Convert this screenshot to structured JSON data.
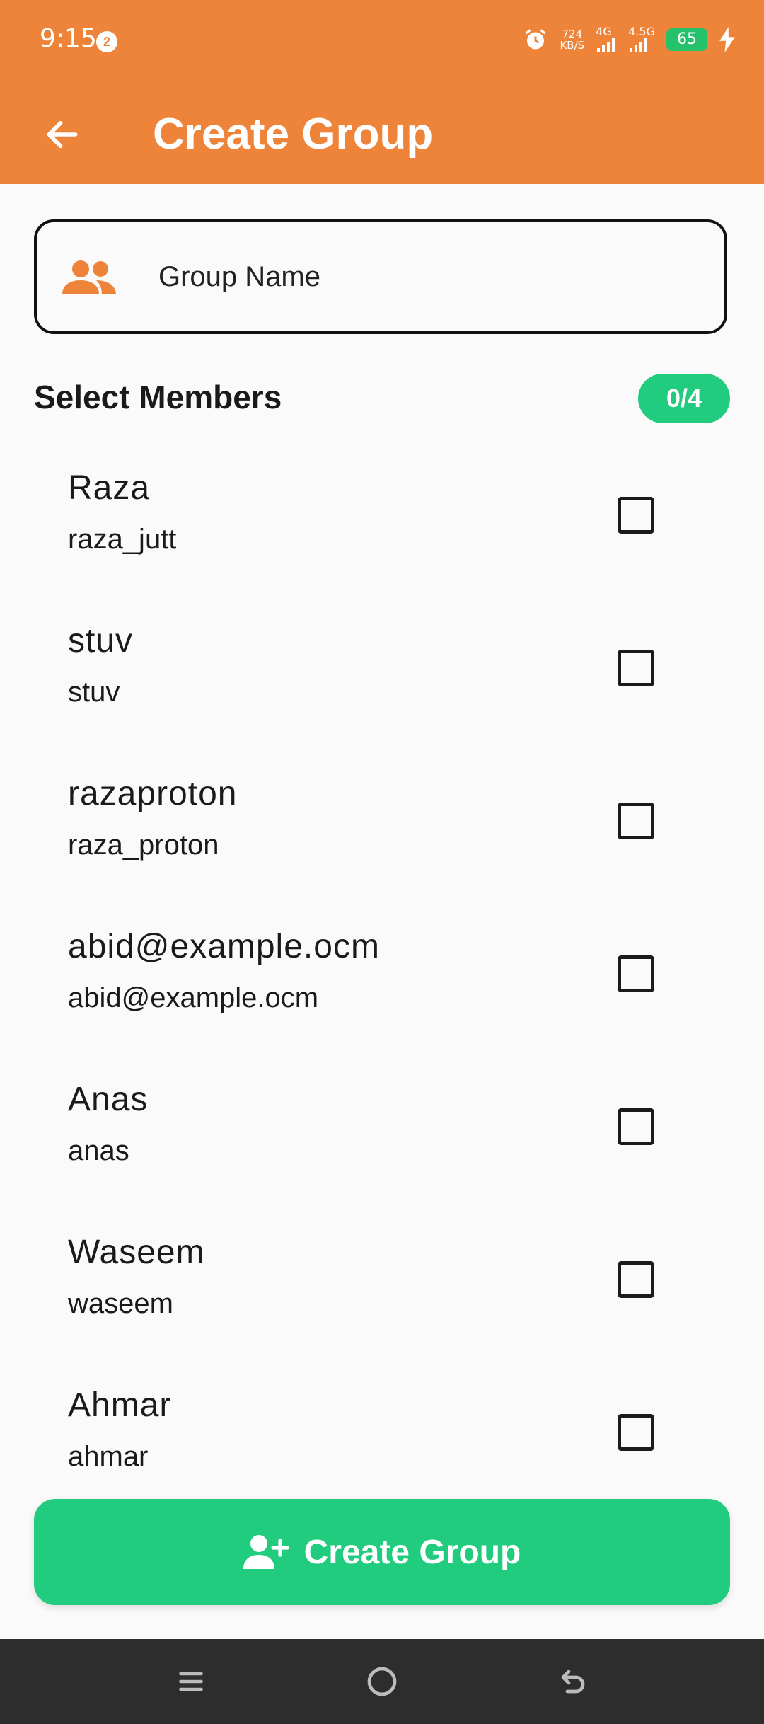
{
  "status_bar": {
    "time": "9:15",
    "notification_count": "2",
    "speed_value": "724",
    "speed_unit": "KB/S",
    "network_1": "4G",
    "network_2": "4.5G",
    "battery": "65"
  },
  "app_bar": {
    "title": "Create Group",
    "back_icon": "arrow-left-icon"
  },
  "group_name": {
    "placeholder": "Group Name",
    "icon": "people-icon"
  },
  "members_section": {
    "title": "Select Members",
    "selected_count": "0/4"
  },
  "members": [
    {
      "name": "Raza",
      "username": "raza_jutt",
      "checked": false
    },
    {
      "name": "stuv",
      "username": "stuv",
      "checked": false
    },
    {
      "name": "razaproton",
      "username": "raza_proton",
      "checked": false
    },
    {
      "name": "abid@example.ocm",
      "username": "abid@example.ocm",
      "checked": false
    },
    {
      "name": "Anas",
      "username": "anas",
      "checked": false
    },
    {
      "name": "Waseem",
      "username": "waseem",
      "checked": false
    },
    {
      "name": "Ahmar",
      "username": "ahmar",
      "checked": false
    }
  ],
  "create_button": {
    "label": "Create Group",
    "icon": "person-add-icon"
  },
  "colors": {
    "accent": "#ee843a",
    "success": "#22cc7e",
    "nav_bar": "#2d2d2d"
  },
  "nav": {
    "menu_icon": "menu-icon",
    "home_icon": "home-circle-icon",
    "back_icon": "back-icon"
  }
}
